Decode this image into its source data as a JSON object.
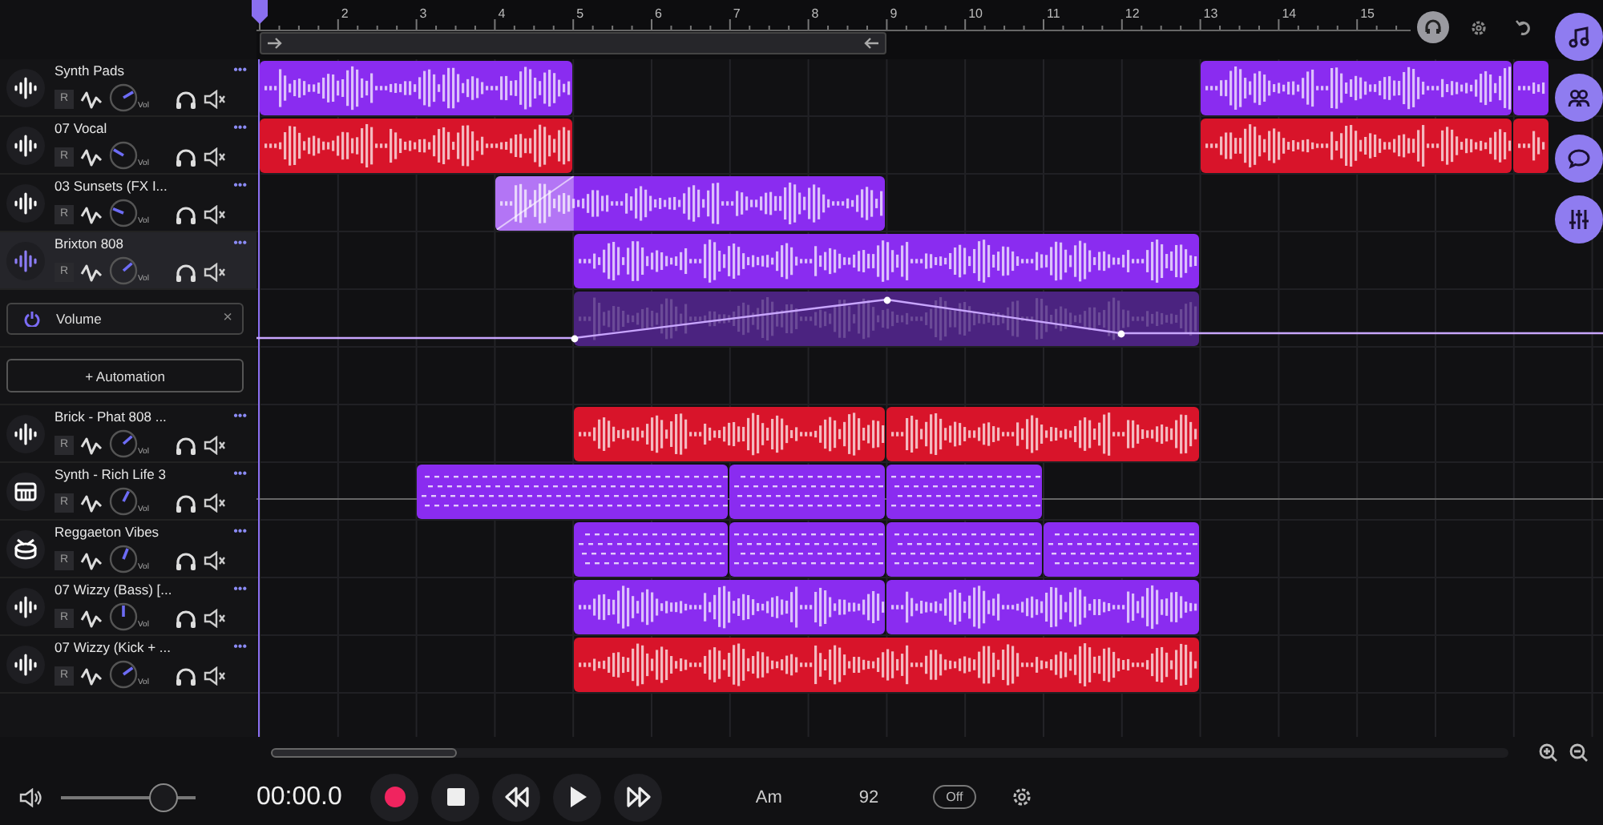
{
  "ruler": {
    "labels": [
      "2",
      "3",
      "4",
      "5",
      "6",
      "7",
      "8",
      "9",
      "10",
      "11",
      "12",
      "13",
      "14",
      "15"
    ]
  },
  "rows": [
    {
      "kind": "track",
      "icon": {
        "kind": "audio"
      },
      "name": "Synth Pads",
      "menu": "•••",
      "rec": "R",
      "knob_label": "Vol",
      "level": 0.72,
      "selected": false,
      "clips": [
        {
          "kind": "audio",
          "color": "#8a2cf0"
        },
        {
          "kind": "audio",
          "color": "#8a2cf0"
        },
        {
          "kind": "audio",
          "color": "#8a2cf0"
        }
      ]
    },
    {
      "kind": "track",
      "icon": {
        "kind": "audio"
      },
      "name": "07 Vocal",
      "menu": "•••",
      "rec": "R",
      "knob_label": "Vol",
      "level": 0.28,
      "selected": false,
      "clips": [
        {
          "kind": "audio",
          "color": "#d8142a"
        },
        {
          "kind": "audio",
          "color": "#d8142a"
        },
        {
          "kind": "audio",
          "color": "#d8142a"
        }
      ]
    },
    {
      "kind": "track",
      "icon": {
        "kind": "audio"
      },
      "name": "03 Sunsets (FX I...",
      "menu": "•••",
      "rec": "R",
      "knob_label": "Vol",
      "level": 0.25,
      "selected": false,
      "clips": [
        {
          "kind": "audio",
          "color": "#8a2cf0",
          "fade_in": true
        }
      ]
    },
    {
      "kind": "track",
      "icon": {
        "kind": "audio"
      },
      "name": "Brixton 808",
      "menu": "•••",
      "rec": "R",
      "knob_label": "Vol",
      "level": 0.68,
      "selected": true,
      "clips": [
        {
          "kind": "audio",
          "color": "#8a2cf0"
        }
      ]
    },
    {
      "kind": "automation",
      "label": "Volume",
      "close": "×",
      "clips": [
        {
          "kind": "envelope",
          "color": "#4b2380"
        }
      ]
    },
    {
      "kind": "add_automation",
      "label": "+ Automation",
      "clips": []
    },
    {
      "kind": "track",
      "icon": {
        "kind": "audio"
      },
      "name": "Brick - Phat 808 ...",
      "menu": "•••",
      "rec": "R",
      "knob_label": "Vol",
      "level": 0.68,
      "selected": false,
      "clips": [
        {
          "kind": "audio",
          "color": "#d8142a"
        },
        {
          "kind": "audio",
          "color": "#d8142a"
        }
      ]
    },
    {
      "kind": "track",
      "icon": {
        "kind": "keys"
      },
      "name": "Synth - Rich Life 3",
      "menu": "•••",
      "rec": "R",
      "knob_label": "Vol",
      "level": 0.6,
      "selected": false,
      "lane_line": true,
      "clips": [
        {
          "kind": "midi",
          "color": "#8a2cf0"
        },
        {
          "kind": "midi",
          "color": "#8a2cf0"
        },
        {
          "kind": "midi",
          "color": "#8a2cf0"
        }
      ]
    },
    {
      "kind": "track",
      "icon": {
        "kind": "drums"
      },
      "name": "Reggaeton Vibes",
      "menu": "•••",
      "rec": "R",
      "knob_label": "Vol",
      "level": 0.58,
      "selected": false,
      "clips": [
        {
          "kind": "midi",
          "color": "#8a2cf0"
        },
        {
          "kind": "midi",
          "color": "#8a2cf0"
        },
        {
          "kind": "midi",
          "color": "#8a2cf0"
        },
        {
          "kind": "midi",
          "color": "#8a2cf0"
        }
      ]
    },
    {
      "kind": "track",
      "icon": {
        "kind": "audio"
      },
      "name": "07 Wizzy (Bass) [...",
      "menu": "•••",
      "rec": "R",
      "knob_label": "Vol",
      "level": 0.5,
      "selected": false,
      "clips": [
        {
          "kind": "audio",
          "color": "#8a2cf0"
        },
        {
          "kind": "audio",
          "color": "#8a2cf0"
        }
      ]
    },
    {
      "kind": "track",
      "icon": {
        "kind": "audio"
      },
      "name": "07 Wizzy (Kick + ...",
      "menu": "•••",
      "rec": "R",
      "knob_label": "Vol",
      "level": 0.7,
      "selected": false,
      "clips": [
        {
          "kind": "audio",
          "color": "#d8142a"
        }
      ]
    }
  ],
  "transport": {
    "time": "00:00.0",
    "key": "Am",
    "tempo": "92",
    "metronome": "Off",
    "volume": {
      "level": 0.76
    }
  }
}
